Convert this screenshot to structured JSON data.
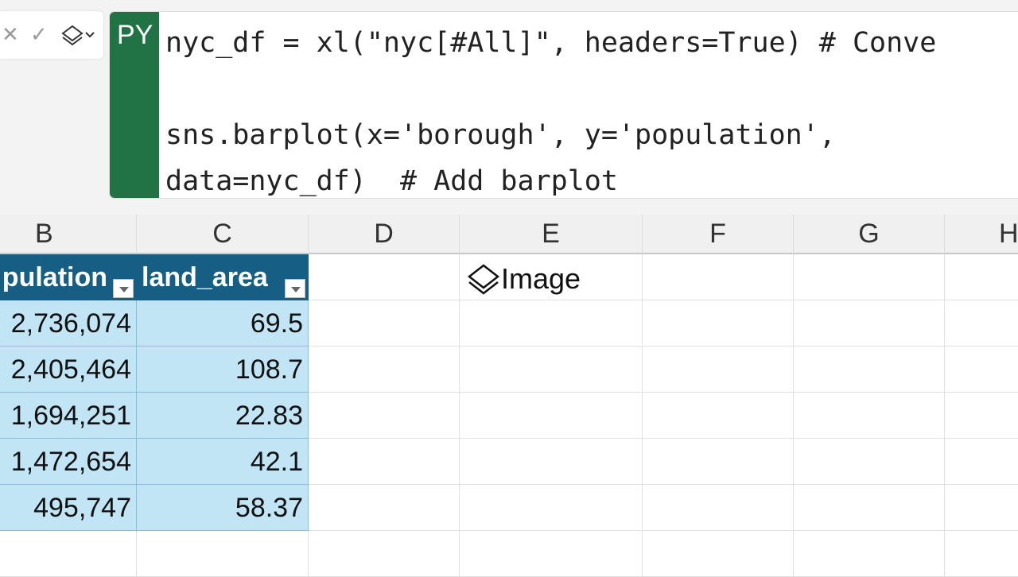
{
  "formula_bar": {
    "cancel_icon": "✕",
    "enter_icon": "✓",
    "mode_icon": "layers-icon",
    "py_badge": "PY",
    "code_lines": [
      "nyc_df = xl(\"nyc[#All]\", headers=True) # Conve",
      "",
      "sns.barplot(x='borough', y='population',",
      "data=nyc_df)  # Add barplot"
    ]
  },
  "columns": [
    "B",
    "C",
    "D",
    "E",
    "F",
    "G",
    "H"
  ],
  "table": {
    "headers": [
      "pulation",
      "land_area"
    ],
    "rows": [
      [
        "2,736,074",
        "69.5"
      ],
      [
        "2,405,464",
        "108.7"
      ],
      [
        "1,694,251",
        "22.83"
      ],
      [
        "1,472,654",
        "42.1"
      ],
      [
        "495,747",
        "58.37"
      ]
    ]
  },
  "image_cell": {
    "label": "Image",
    "icon": "layers-icon"
  },
  "colors": {
    "python_green": "#217346",
    "table_header": "#175e84",
    "table_row": "#c2e5f6"
  }
}
